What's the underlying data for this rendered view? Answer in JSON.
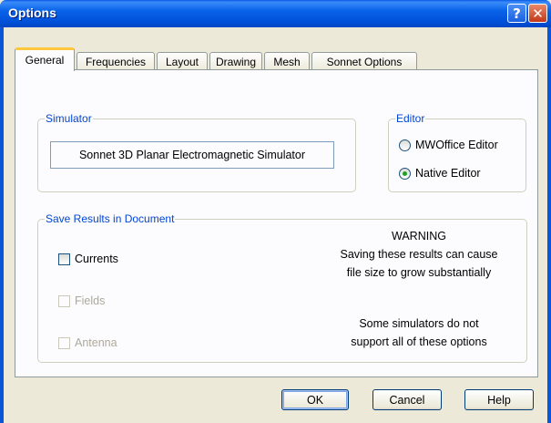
{
  "window": {
    "title": "Options",
    "help_glyph": "?",
    "close_glyph": "✕"
  },
  "tabs": [
    {
      "label": "General",
      "active": true
    },
    {
      "label": "Frequencies",
      "active": false
    },
    {
      "label": "Layout",
      "active": false
    },
    {
      "label": "Drawing",
      "active": false
    },
    {
      "label": "Mesh",
      "active": false
    },
    {
      "label": "Sonnet Options",
      "active": false
    }
  ],
  "simulator": {
    "legend": "Simulator",
    "value": "Sonnet 3D Planar Electromagnetic Simulator"
  },
  "editor": {
    "legend": "Editor",
    "options": [
      {
        "label": "MWOffice Editor",
        "selected": false
      },
      {
        "label": "Native Editor",
        "selected": true
      }
    ]
  },
  "save_results": {
    "legend": "Save Results in Document",
    "checkboxes": [
      {
        "label": "Currents",
        "checked": false,
        "enabled": true
      },
      {
        "label": "Fields",
        "checked": false,
        "enabled": false
      },
      {
        "label": "Antenna",
        "checked": false,
        "enabled": false
      }
    ],
    "warning_title": "WARNING",
    "warning_line1": "Saving these results can cause",
    "warning_line2": "file size to grow substantially",
    "note_line1": "Some simulators do not",
    "note_line2": "support all of these options"
  },
  "buttons": {
    "ok": "OK",
    "cancel": "Cancel",
    "help": "Help"
  },
  "colors": {
    "titlebar": "#0054e3",
    "group_legend": "#0046d5",
    "tab_highlight": "#ffc83c",
    "face": "#ece9d8"
  }
}
